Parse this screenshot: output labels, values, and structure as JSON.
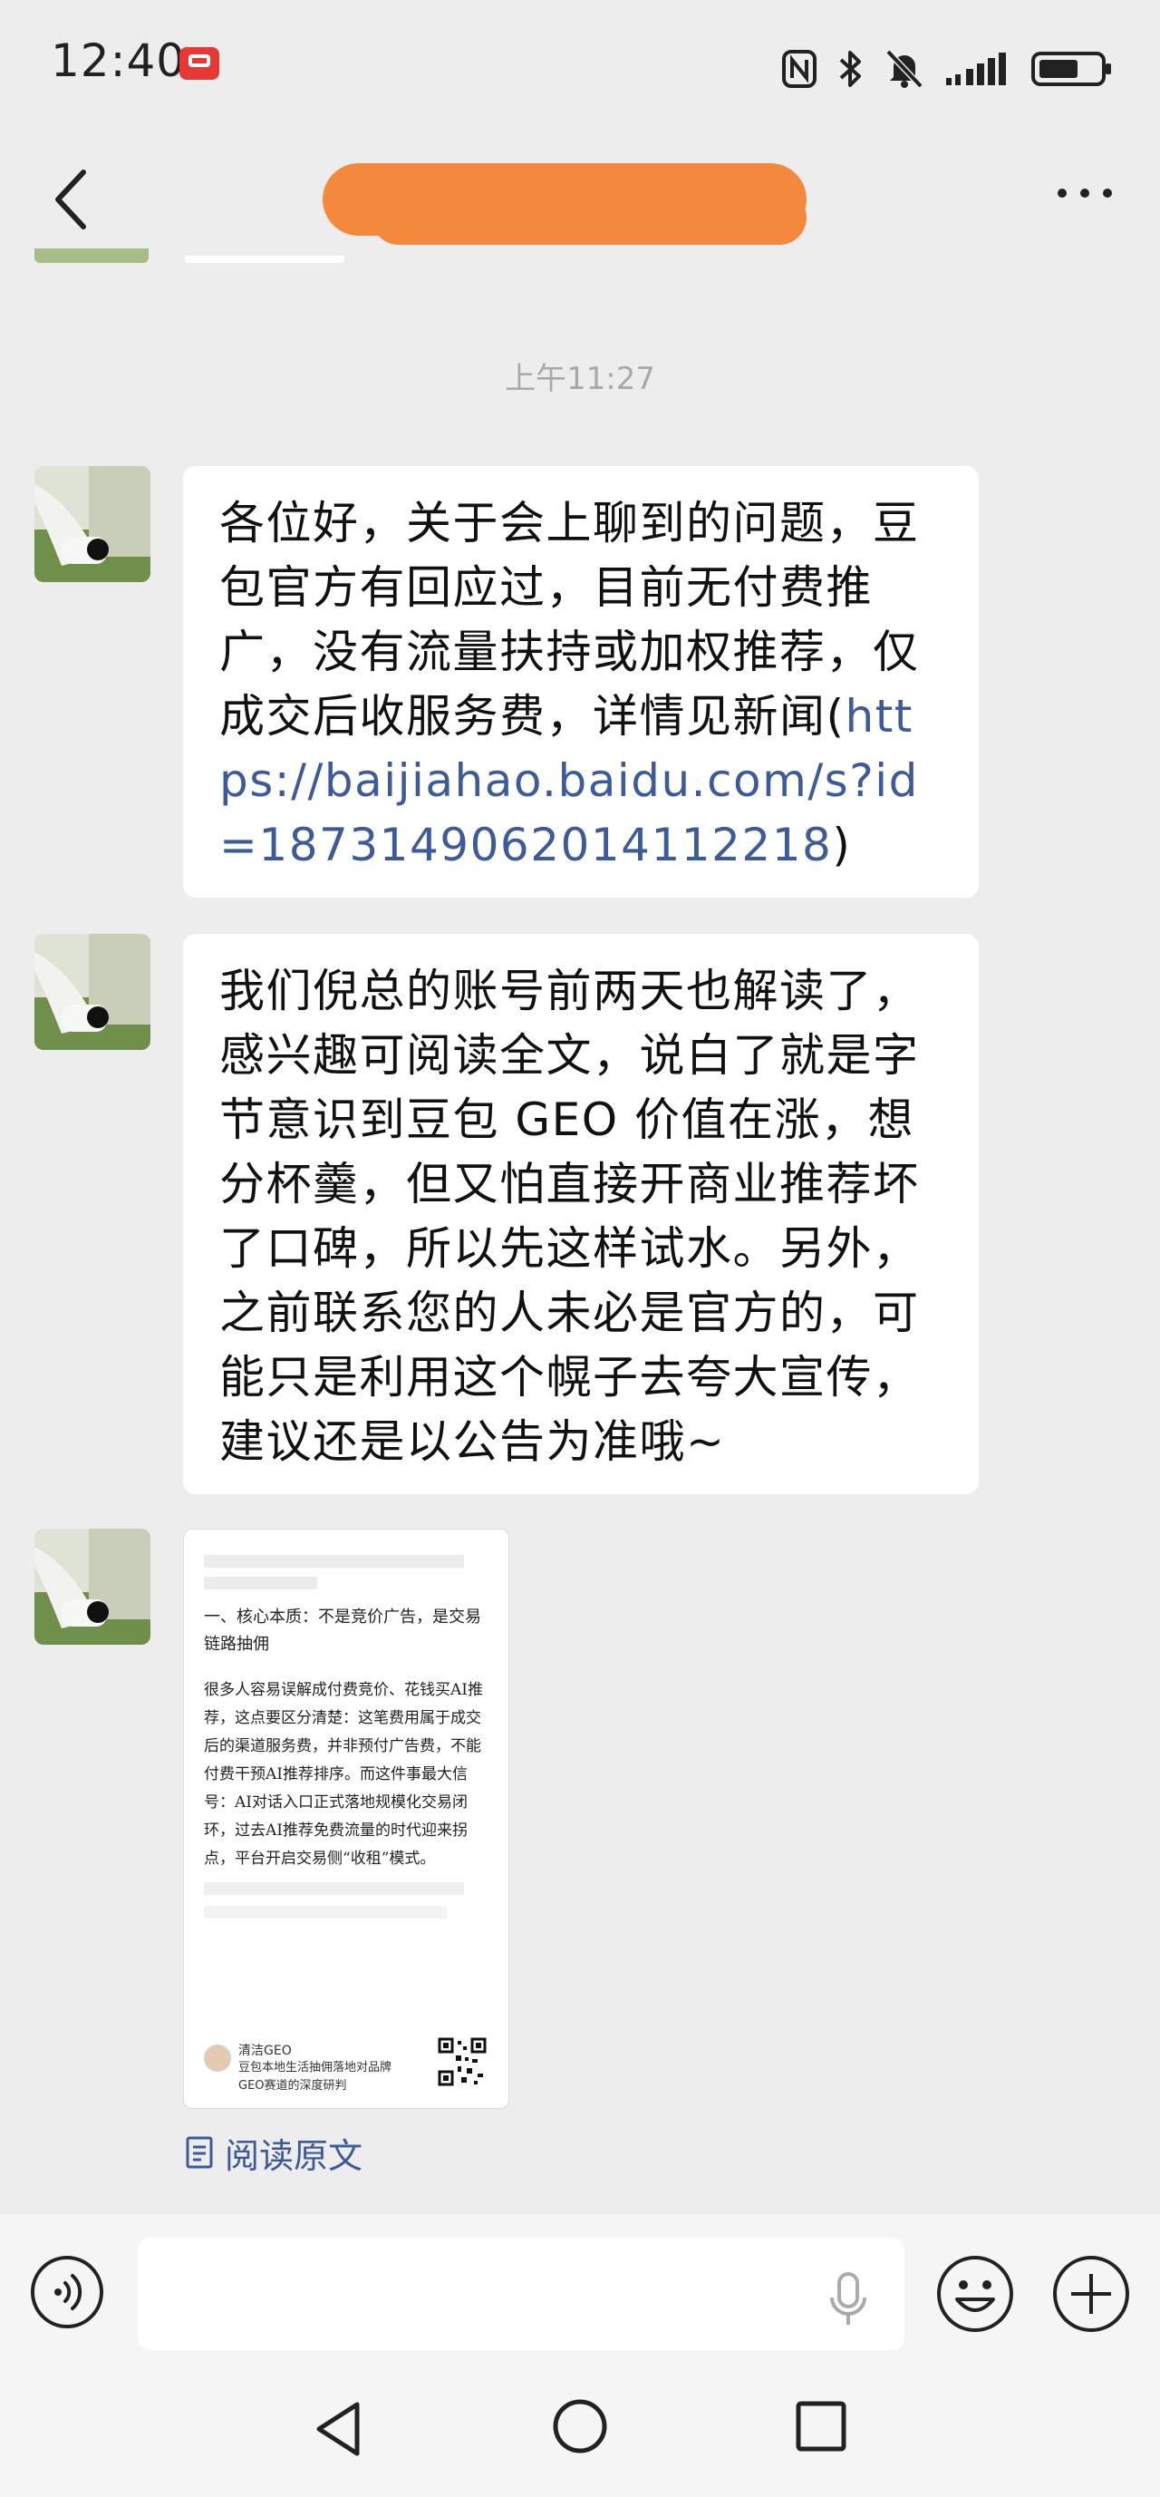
{
  "status_bar": {
    "time": "12:40",
    "icons": [
      "nfc-icon",
      "bluetooth-icon",
      "mute-icon",
      "signal-icon",
      "battery-icon"
    ],
    "battery_level": 0.55
  },
  "header": {
    "back_icon": "chevron-left-icon",
    "more_icon": "more-dots-icon",
    "title": ""
  },
  "chat": {
    "timestamp": "上午11:27",
    "messages": [
      {
        "type": "text",
        "text_before_link": "各位好，关于会上聊到的问题，豆包官方有回应过，目前无付费推广，没有流量扶持或加权推荐，仅成交后收服务费，详情见新闻(",
        "link": "https://baijiahao.baidu.com/s?id=1873149062014112218",
        "text_after_link": ")"
      },
      {
        "type": "text",
        "text": "我们倪总的账号前两天也解读了，感兴趣可阅读全文，说白了就是字节意识到豆包 GEO 价值在涨，想分杯羹，但又怕直接开商业推荐坏了口碑，所以先这样试水。另外，之前联系您的人未必是官方的，可能只是利用这个幌子去夸大宣传，建议还是以公告为准哦~"
      },
      {
        "type": "card",
        "card_heading": "一、核心本质：不是竞价广告，是交易链路抽佣",
        "card_body": "很多人容易误解成付费竞价、花钱买AI推荐，这点要区分清楚：这笔费用属于成交后的渠道服务费，并非预付广告费，不能付费干预AI推荐排序。而这件事最大信号：AI对话入口正式落地规模化交易闭环，过去AI推荐免费流量的时代迎来拐点，平台开启交易侧“收租”模式。",
        "card_author": "清洁GEO",
        "card_title": "豆包本地生活抽佣落地对品牌GEO赛道的深度研判"
      }
    ],
    "read_original": "阅读原文"
  },
  "input_bar": {
    "voice_icon": "voice-icon",
    "input_value": "",
    "mic_icon": "mic-icon",
    "emoji_icon": "emoji-icon",
    "plus_icon": "plus-icon"
  },
  "system_nav": {
    "icons": [
      "back-triangle-icon",
      "home-circle-icon",
      "recent-square-icon"
    ]
  }
}
